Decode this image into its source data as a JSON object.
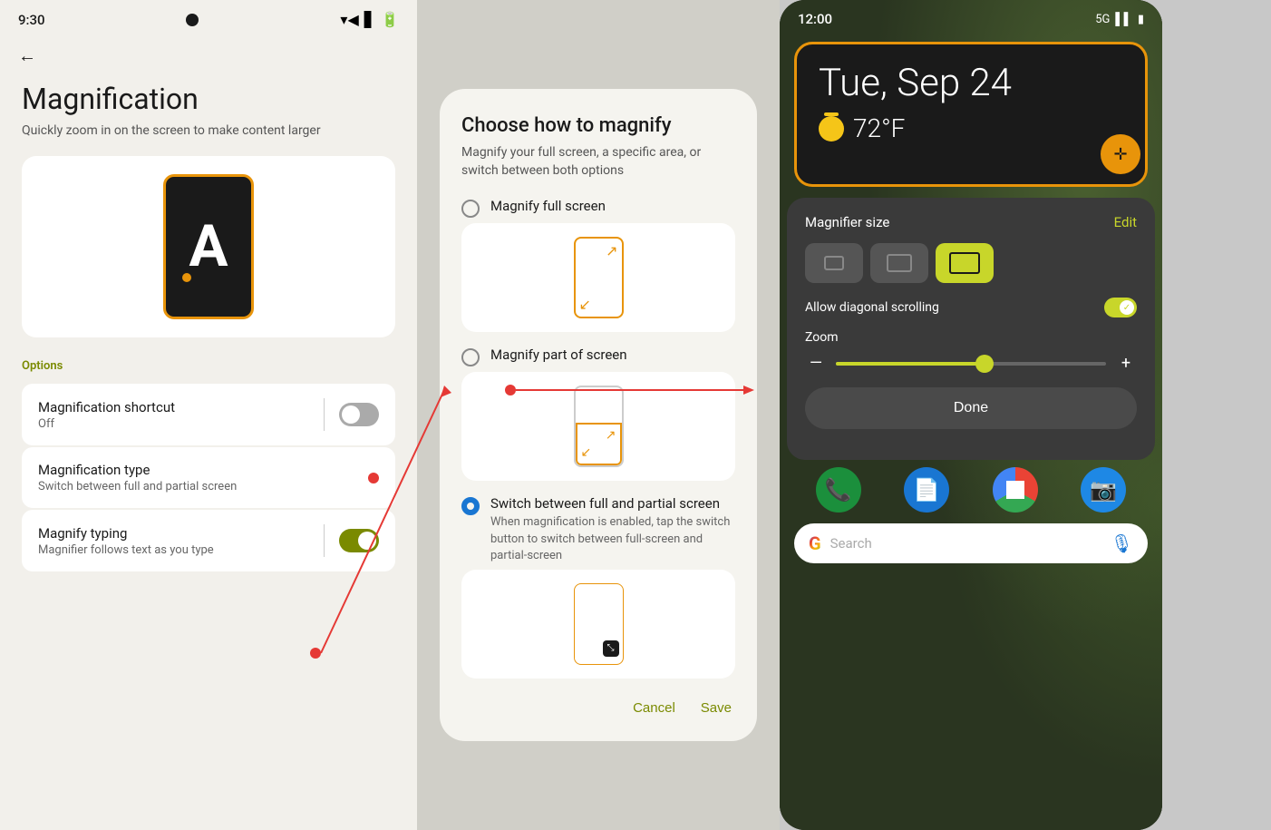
{
  "panel1": {
    "statusBar": {
      "time": "9:30",
      "icons": [
        "wifi",
        "signal",
        "battery"
      ]
    },
    "backArrow": "←",
    "title": "Magnification",
    "subtitle": "Quickly zoom in on the screen to make content larger",
    "phoneLetter": "A",
    "optionsLabel": "Options",
    "settings": [
      {
        "id": "shortcut",
        "title": "Magnification shortcut",
        "subtitle": "Off",
        "hasToggle": true,
        "toggleOn": false,
        "hasDivider": true
      },
      {
        "id": "type",
        "title": "Magnification type",
        "subtitle": "Switch between full and partial screen",
        "hasToggle": false,
        "hasDivider": false,
        "hasRedDot": true
      },
      {
        "id": "typing",
        "title": "Magnify typing",
        "subtitle": "Magnifier follows text as you type",
        "hasToggle": true,
        "toggleOn": true,
        "hasDivider": true
      }
    ]
  },
  "panel2": {
    "dialogTitle": "Choose how to magnify",
    "dialogSubtitle": "Magnify your full screen, a specific area, or switch between both options",
    "options": [
      {
        "id": "fullscreen",
        "label": "Magnify full screen",
        "selected": false,
        "description": ""
      },
      {
        "id": "partial",
        "label": "Magnify part of screen",
        "selected": false,
        "description": "",
        "hasRedDot": true
      },
      {
        "id": "switch",
        "label": "Switch between full and partial screen",
        "selected": true,
        "description": "When magnification is enabled, tap the switch button to switch between full-screen and partial-screen"
      }
    ],
    "cancelLabel": "Cancel",
    "saveLabel": "Save"
  },
  "panel3": {
    "statusBar": {
      "time": "12:00",
      "signal": "5G"
    },
    "clockDate": "Tue, Sep 24",
    "weatherTemp": "72°F",
    "magnifierSize": {
      "label": "Magnifier size",
      "editLabel": "Edit",
      "sizes": [
        "small",
        "medium",
        "large"
      ],
      "activeSize": "large"
    },
    "diagonalScrolling": {
      "label": "Allow diagonal scrolling",
      "enabled": true
    },
    "zoom": {
      "label": "Zoom",
      "value": 55
    },
    "doneLabel": "Done",
    "apps": [
      "📞",
      "📄",
      "🌐",
      "📷"
    ],
    "googlePlaceholder": "Search"
  }
}
